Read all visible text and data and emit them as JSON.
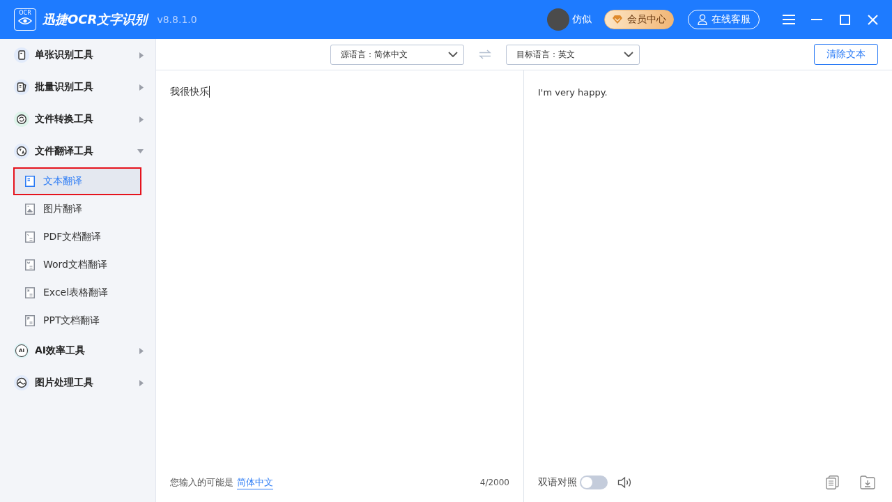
{
  "title_bar": {
    "logo_text": "OCR",
    "app_name": "迅捷OCR文字识别",
    "version": "v8.8.1.0",
    "user_name": "仿似",
    "vip_button": "会员中心",
    "service_button": "在线客服"
  },
  "sidebar": {
    "items": [
      {
        "label": "单张识别工具",
        "expanded": false
      },
      {
        "label": "批量识别工具",
        "expanded": false
      },
      {
        "label": "文件转换工具",
        "expanded": false
      },
      {
        "label": "文件翻译工具",
        "expanded": true,
        "children": [
          {
            "label": "文本翻译",
            "selected": true
          },
          {
            "label": "图片翻译",
            "selected": false
          },
          {
            "label": "PDF文档翻译",
            "selected": false
          },
          {
            "label": "Word文档翻译",
            "selected": false
          },
          {
            "label": "Excel表格翻译",
            "selected": false
          },
          {
            "label": "PPT文档翻译",
            "selected": false
          }
        ]
      },
      {
        "label": "AI效率工具",
        "icon_text": "AI",
        "expanded": false
      },
      {
        "label": "图片处理工具",
        "expanded": false
      }
    ]
  },
  "toolbar": {
    "source_language": "源语言：简体中文",
    "target_language": "目标语言：英文",
    "clear_button": "清除文本"
  },
  "input_pane": {
    "value": "我很快乐",
    "detected_prefix": "您输入的可能是",
    "detected_language": "简体中文",
    "char_count": "4/2000"
  },
  "output_pane": {
    "text": "I'm very happy.",
    "bilingual_label": "双语对照",
    "bilingual_on": false
  }
}
